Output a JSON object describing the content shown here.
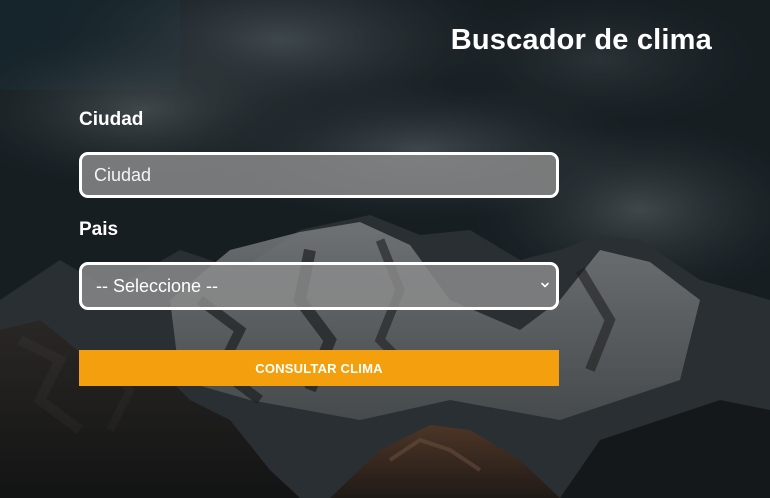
{
  "header": {
    "title": "Buscador de clima"
  },
  "form": {
    "city_label": "Ciudad",
    "city_placeholder": "Ciudad",
    "city_value": "",
    "country_label": "Pais",
    "country_selected": "-- Seleccione --",
    "submit_label": "CONSULTAR CLIMA"
  },
  "colors": {
    "accent": "#f49f0d",
    "field_bg": "#8c8c8c",
    "text": "#ffffff"
  },
  "icons": {
    "select_arrow": "chevron-down-icon"
  }
}
